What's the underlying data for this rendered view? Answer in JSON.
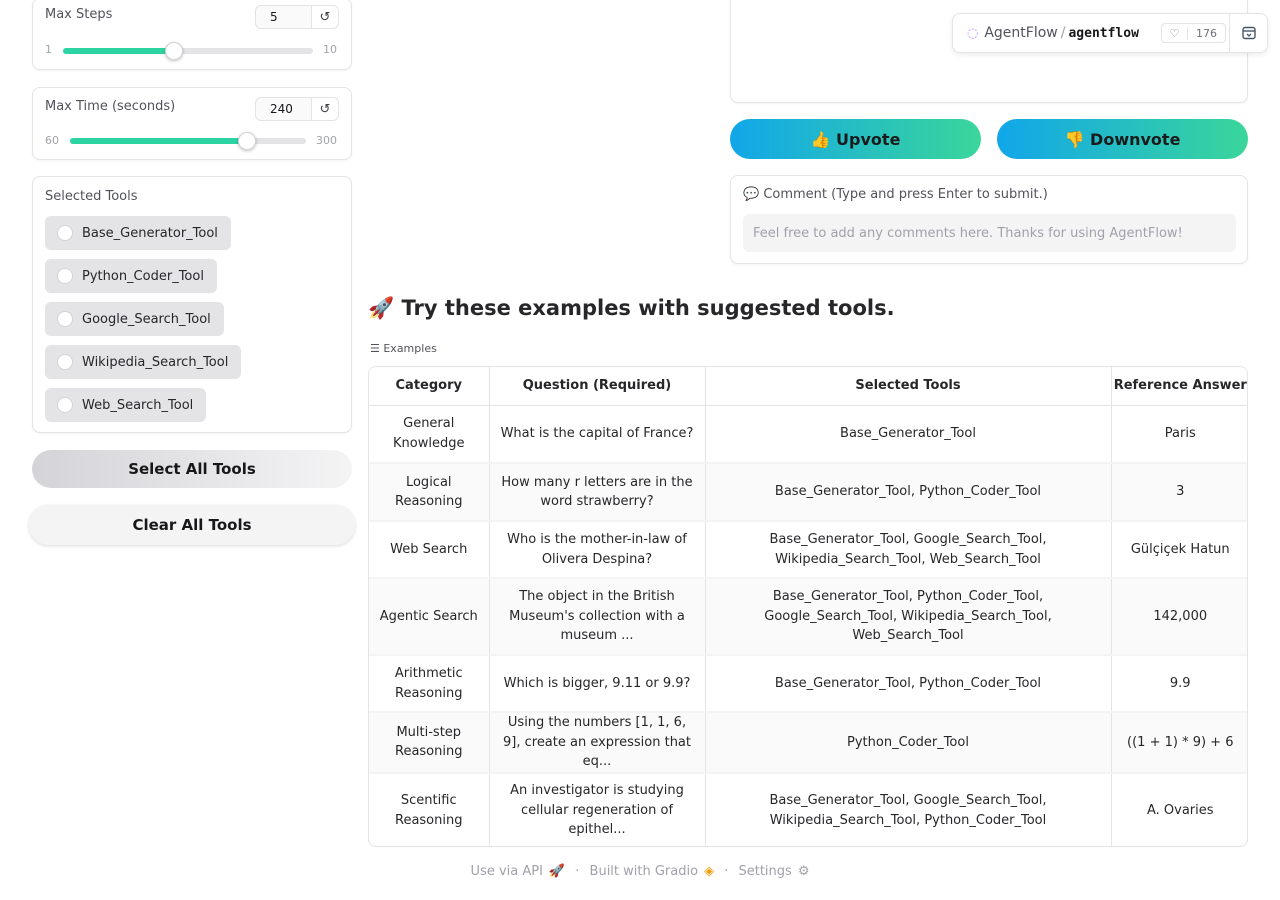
{
  "max_steps": {
    "label": "Max Steps",
    "value": "5",
    "min": "1",
    "max": "10",
    "fraction": 0.444
  },
  "max_time": {
    "label": "Max Time (seconds)",
    "value": "240",
    "min": "60",
    "max": "300",
    "fraction": 0.75
  },
  "tools": {
    "label": "Selected Tools",
    "items": [
      "Base_Generator_Tool",
      "Python_Coder_Tool",
      "Google_Search_Tool",
      "Wikipedia_Search_Tool",
      "Web_Search_Tool"
    ]
  },
  "buttons": {
    "select_all": "Select All Tools",
    "clear_all": "Clear All Tools"
  },
  "header": {
    "org": "AgentFlow",
    "separator": "/",
    "repo": "agentflow",
    "likes": "176"
  },
  "vote": {
    "up": "👍 Upvote",
    "down": "👎 Downvote"
  },
  "comment": {
    "label": "💬 Comment (Type and press Enter to submit.)",
    "placeholder": "Feel free to add any comments here. Thanks for using AgentFlow!"
  },
  "examples": {
    "title": "🚀 Try these examples with suggested tools.",
    "label": "☰ Examples",
    "columns": [
      "Category",
      "Question (Required)",
      "Selected Tools",
      "Reference Answer"
    ],
    "rows": [
      {
        "category": "General Knowledge",
        "question": "What is the capital of France?",
        "tools": "Base_Generator_Tool",
        "answer": "Paris"
      },
      {
        "category": "Logical Reasoning",
        "question": "How many r letters are in the word strawberry?",
        "tools": "Base_Generator_Tool, Python_Coder_Tool",
        "answer": "3"
      },
      {
        "category": "Web Search",
        "question": "Who is the mother-in-law of Olivera Despina?",
        "tools": "Base_Generator_Tool, Google_Search_Tool, Wikipedia_Search_Tool, Web_Search_Tool",
        "answer": "Gülçiçek Hatun"
      },
      {
        "category": "Agentic Search",
        "question": "The object in the British Museum's collection with a museum ...",
        "tools": "Base_Generator_Tool, Python_Coder_Tool, Google_Search_Tool, Wikipedia_Search_Tool, Web_Search_Tool",
        "answer": "142,000"
      },
      {
        "category": "Arithmetic Reasoning",
        "question": "Which is bigger, 9.11 or 9.9?",
        "tools": "Base_Generator_Tool, Python_Coder_Tool",
        "answer": "9.9"
      },
      {
        "category": "Multi-step Reasoning",
        "question": "Using the numbers [1, 1, 6, 9], create an expression that eq...",
        "tools": "Python_Coder_Tool",
        "answer": "((1 + 1) * 9) + 6"
      },
      {
        "category": "Scentific Reasoning",
        "question": "An investigator is studying cellular regeneration of epithel...",
        "tools": "Base_Generator_Tool, Google_Search_Tool, Wikipedia_Search_Tool, Python_Coder_Tool",
        "answer": "A. Ovaries"
      }
    ]
  },
  "footer": {
    "api": "Use via API",
    "built": "Built with Gradio",
    "settings": "Settings",
    "dot": "·"
  },
  "colors": {
    "slider_fill": "#2dd4a3",
    "vote_gradient_start": "#11a6ea",
    "vote_gradient_end": "#3ad69a"
  }
}
